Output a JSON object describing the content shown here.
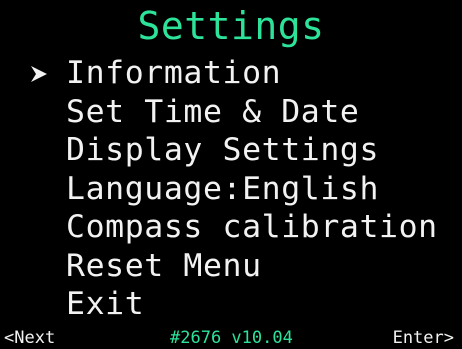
{
  "screen": {
    "title": "Settings",
    "accent_color": "#2de39a",
    "text_color": "#f2f2f2",
    "background_color": "#000000"
  },
  "menu": {
    "selected_index": 0,
    "cursor_icon": "right-arrow-cursor",
    "items": [
      {
        "label": "Information"
      },
      {
        "label": "Set Time & Date"
      },
      {
        "label": "Display Settings"
      },
      {
        "label": "Language:English"
      },
      {
        "label": "Compass calibration"
      },
      {
        "label": "Reset Menu"
      },
      {
        "label": "Exit"
      }
    ]
  },
  "footer": {
    "left_label": "<Next",
    "center_label": "#2676 v10.04",
    "right_label": "Enter>"
  }
}
